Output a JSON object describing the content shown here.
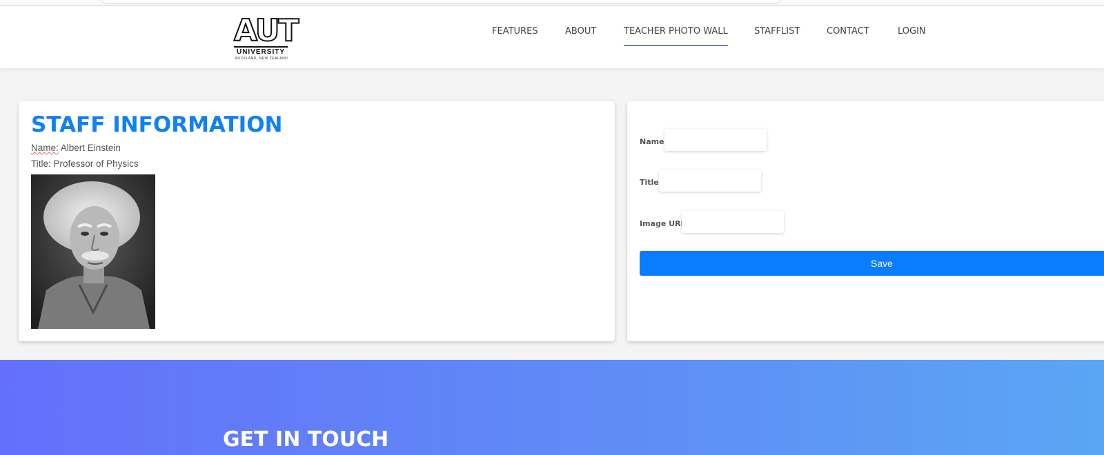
{
  "logo": {
    "main": "AUT",
    "sub": "UNIVERSITY",
    "location": "AUCKLAND, NEW ZEALAND"
  },
  "nav": {
    "items": [
      {
        "label": "FEATURES"
      },
      {
        "label": "ABOUT"
      },
      {
        "label": "TEACHER PHOTO WALL",
        "active": true
      },
      {
        "label": "STAFFLIST"
      },
      {
        "label": "CONTACT"
      },
      {
        "label": "LOGIN"
      }
    ],
    "active_color": "#6a7ef5"
  },
  "staff": {
    "heading": "STAFF INFORMATION",
    "name_label": "Name:",
    "name_value": "Albert Einstein",
    "title_label": "Title:",
    "title_value": "Professor of Physics",
    "heading_color": "#1080f5"
  },
  "form": {
    "name_label": "Name:",
    "name_value": "",
    "title_label": "Title:",
    "title_value": "",
    "image_url_label": "Image URL:",
    "image_url_value": "",
    "save_label": "Save",
    "button_color": "#0a7cff"
  },
  "contact": {
    "heading": "GET IN TOUCH"
  }
}
